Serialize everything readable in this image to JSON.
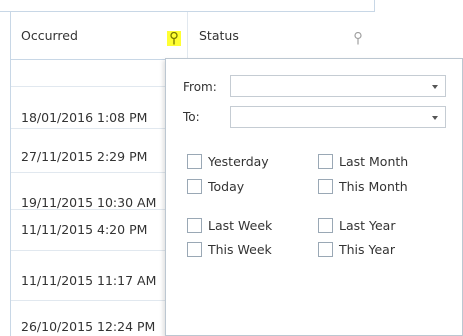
{
  "grid": {
    "columns": [
      {
        "label": "Occurred",
        "filter_active": true
      },
      {
        "label": "Status",
        "filter_active": false
      }
    ],
    "rows": [
      "",
      "18/01/2016 1:08 PM",
      "27/11/2015 2:29 PM",
      "19/11/2015 10:30 AM",
      "11/11/2015 4:20 PM",
      "11/11/2015 11:17 AM",
      "26/10/2015 12:24 PM"
    ]
  },
  "date_filter": {
    "from_label": "From:",
    "from_value": "",
    "to_label": "To:",
    "to_value": "",
    "options": [
      {
        "label": "Yesterday",
        "checked": false
      },
      {
        "label": "Last Month",
        "checked": false
      },
      {
        "label": "Today",
        "checked": false
      },
      {
        "label": "This Month",
        "checked": false
      },
      {
        "label": "Last Week",
        "checked": false
      },
      {
        "label": "Last Year",
        "checked": false
      },
      {
        "label": "This Week",
        "checked": false
      },
      {
        "label": "This Year",
        "checked": false
      }
    ]
  },
  "colors": {
    "active_filter_highlight": "#ffff33",
    "grid_border": "#c8d7e6"
  },
  "icons": {
    "filter": "pin-filter-icon"
  }
}
